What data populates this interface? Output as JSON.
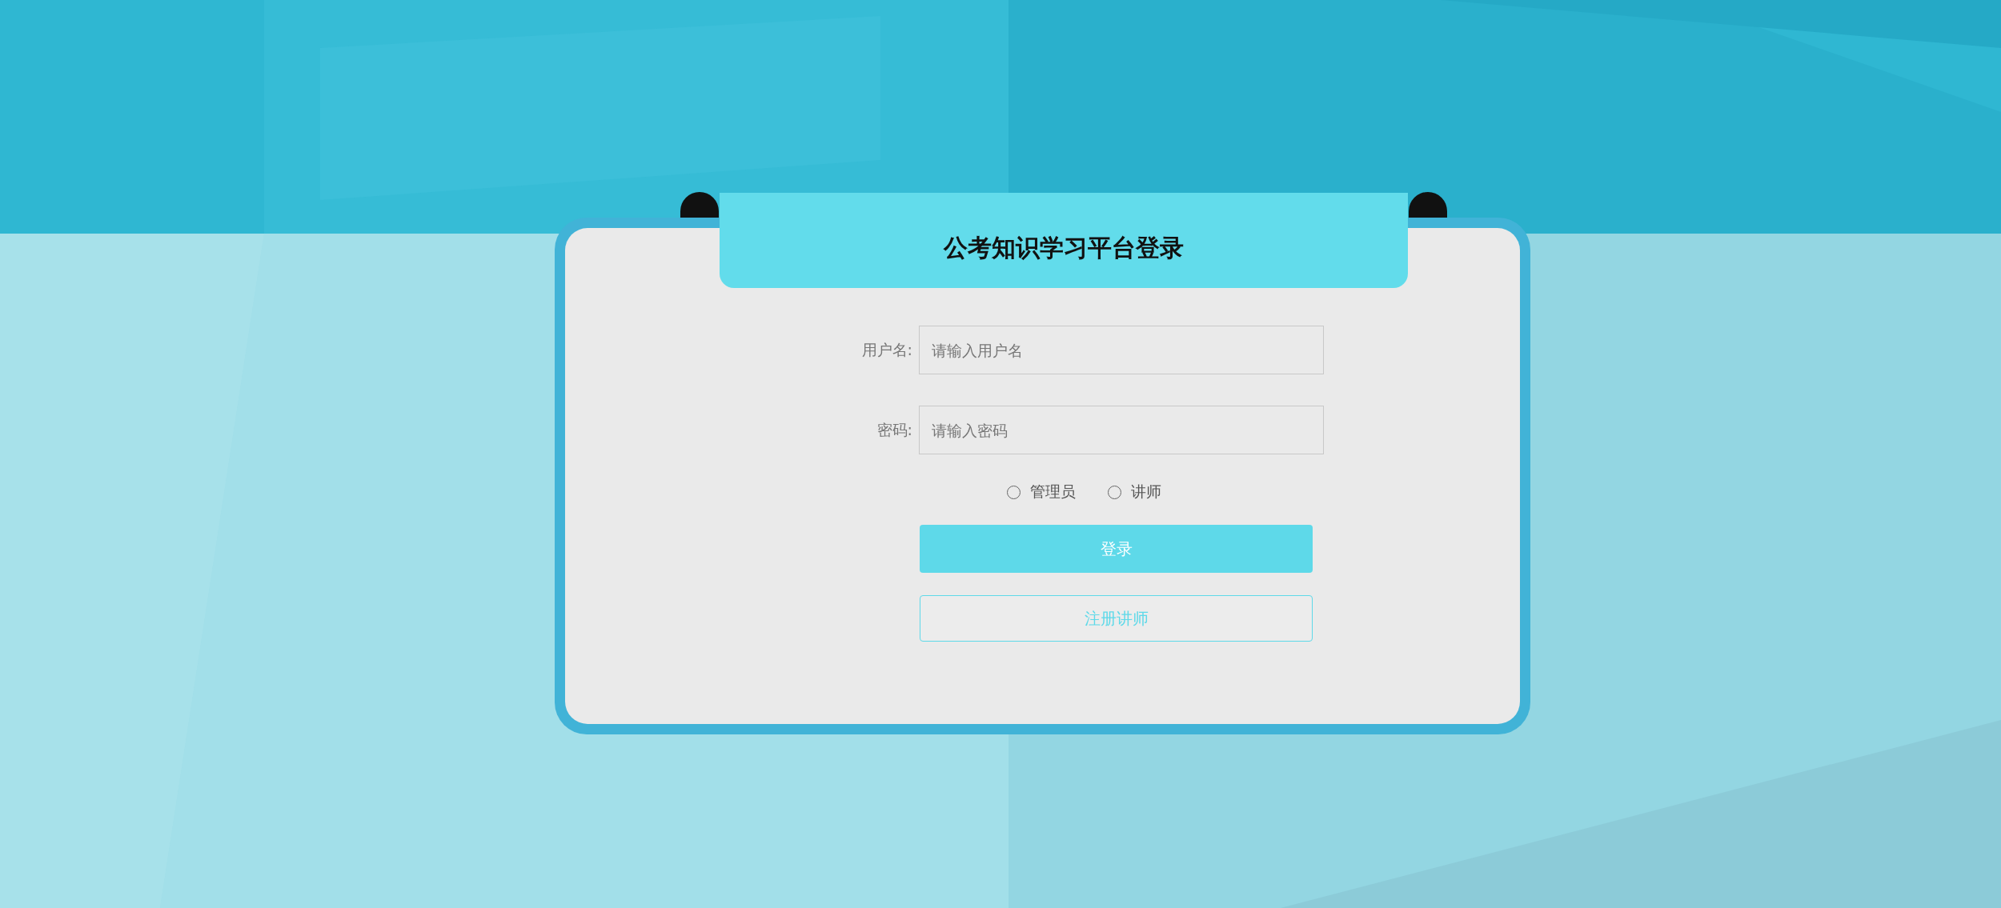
{
  "title": "公考知识学习平台登录",
  "fields": [
    {
      "label": "用户名:",
      "placeholder": "请输入用户名"
    },
    {
      "label": "密码:",
      "placeholder": "请输入密码"
    }
  ],
  "roles": [
    {
      "label": "管理员",
      "selected": false
    },
    {
      "label": "讲师",
      "selected": false
    }
  ],
  "buttons": [
    {
      "label": "登录",
      "kind": "primary"
    },
    {
      "label": "注册讲师",
      "kind": "outline"
    }
  ]
}
